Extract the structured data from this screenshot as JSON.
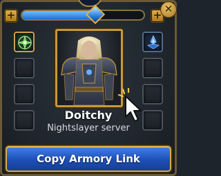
{
  "header": {
    "add_icon": "plus-icon",
    "progress_fraction": 0.6,
    "close_icon": "close-x-icon"
  },
  "character": {
    "name": "Doitchy",
    "server": "Nightslayer server"
  },
  "left_slots": [
    {
      "icon": "green-emblem-icon",
      "active": true
    },
    {
      "icon": "",
      "active": false
    },
    {
      "icon": "",
      "active": false
    },
    {
      "icon": "",
      "active": false
    }
  ],
  "right_slots": [
    {
      "icon": "blue-emblem-icon",
      "active": true
    },
    {
      "icon": "",
      "active": false
    },
    {
      "icon": "",
      "active": false
    },
    {
      "icon": "",
      "active": false
    }
  ],
  "actions": {
    "copy_label": "Copy Armory Link"
  },
  "colors": {
    "gold_border": "#c79a3a",
    "button_blue": "#1d4fb8",
    "progress_blue": "#1e6fd6"
  }
}
